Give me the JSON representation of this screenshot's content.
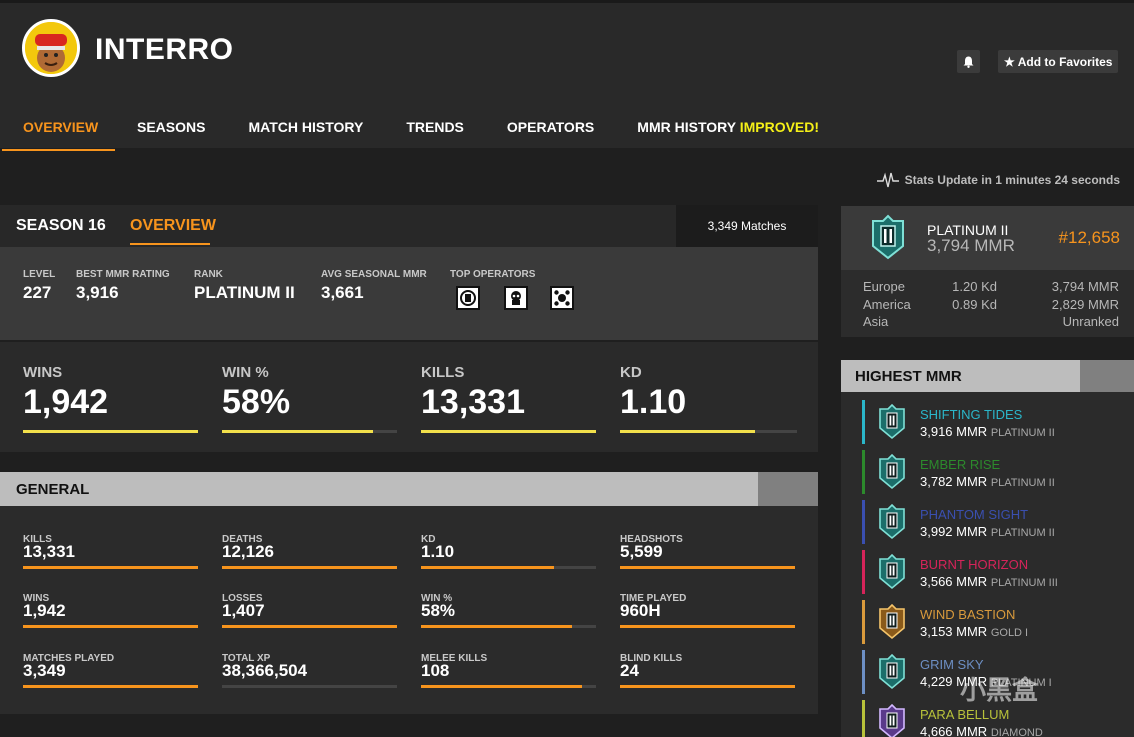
{
  "player": {
    "name": "INTERRO"
  },
  "header": {
    "favorites_label": "Add to Favorites"
  },
  "tabs": [
    {
      "label": "OVERVIEW"
    },
    {
      "label": "SEASONS"
    },
    {
      "label": "MATCH HISTORY"
    },
    {
      "label": "TRENDS"
    },
    {
      "label": "OPERATORS"
    },
    {
      "label": "MMR HISTORY",
      "badge": "IMPROVED!"
    }
  ],
  "stats_update": "Stats Update in 1 minutes 24 seconds",
  "season": {
    "label": "SEASON 16",
    "tab": "OVERVIEW",
    "matches": "3,349 Matches",
    "info": [
      {
        "label": "LEVEL",
        "value": "227"
      },
      {
        "label": "BEST MMR RATING",
        "value": "3,916"
      },
      {
        "label": "RANK",
        "value": "PLATINUM II"
      },
      {
        "label": "AVG SEASONAL MMR",
        "value": "3,661"
      },
      {
        "label": "TOP OPERATORS",
        "value": ""
      }
    ],
    "top_operator_icons": [
      "operator-1-icon",
      "operator-2-icon",
      "operator-3-icon"
    ]
  },
  "big_stats": [
    {
      "label": "WINS",
      "value": "1,942",
      "fill": 1.0
    },
    {
      "label": "WIN %",
      "value": "58%",
      "fill": 0.86
    },
    {
      "label": "KILLS",
      "value": "13,331",
      "fill": 1.0
    },
    {
      "label": "KD",
      "value": "1.10",
      "fill": 0.76
    }
  ],
  "general": {
    "title": "GENERAL",
    "stats": [
      {
        "label": "KILLS",
        "value": "13,331",
        "fill": 1.0
      },
      {
        "label": "DEATHS",
        "value": "12,126",
        "fill": 1.0
      },
      {
        "label": "KD",
        "value": "1.10",
        "fill": 0.76
      },
      {
        "label": "HEADSHOTS",
        "value": "5,599",
        "fill": 1.0
      },
      {
        "label": "WINS",
        "value": "1,942",
        "fill": 1.0
      },
      {
        "label": "LOSSES",
        "value": "1,407",
        "fill": 1.0
      },
      {
        "label": "WIN %",
        "value": "58%",
        "fill": 0.86
      },
      {
        "label": "TIME PLAYED",
        "value": "960H",
        "fill": 1.0
      },
      {
        "label": "MATCHES PLAYED",
        "value": "3,349",
        "fill": 1.0
      },
      {
        "label": "TOTAL XP",
        "value": "38,366,504",
        "fill": 0.0
      },
      {
        "label": "MELEE KILLS",
        "value": "108",
        "fill": 0.92
      },
      {
        "label": "BLIND KILLS",
        "value": "24",
        "fill": 1.0
      }
    ]
  },
  "rank_card": {
    "rank": "PLATINUM II",
    "mmr": "3,794 MMR",
    "position": "#12,658",
    "regions": [
      {
        "name": "Europe",
        "kd": "1.20 Kd",
        "mmr": "3,794 MMR"
      },
      {
        "name": "America",
        "kd": "0.89 Kd",
        "mmr": "2,829 MMR"
      },
      {
        "name": "Asia",
        "kd": "",
        "mmr": "Unranked"
      }
    ]
  },
  "highest_mmr": {
    "title": "HIGHEST MMR",
    "seasons": [
      {
        "name": "SHIFTING TIDES",
        "mmr": "3,916 MMR",
        "rank": "PLATINUM II",
        "color": "#2bb6c9"
      },
      {
        "name": "EMBER RISE",
        "mmr": "3,782 MMR",
        "rank": "PLATINUM II",
        "color": "#2c8a2c"
      },
      {
        "name": "PHANTOM SIGHT",
        "mmr": "3,992 MMR",
        "rank": "PLATINUM II",
        "color": "#3a4fb0"
      },
      {
        "name": "BURNT HORIZON",
        "mmr": "3,566 MMR",
        "rank": "PLATINUM III",
        "color": "#d6245a"
      },
      {
        "name": "WIND BASTION",
        "mmr": "3,153 MMR",
        "rank": "GOLD I",
        "color": "#d99a3c"
      },
      {
        "name": "GRIM SKY",
        "mmr": "4,229 MMR",
        "rank": "PLATINUM I",
        "color": "#6d8fc4"
      },
      {
        "name": "PARA BELLUM",
        "mmr": "4,666 MMR",
        "rank": "DIAMOND",
        "color": "#b8c23a"
      }
    ]
  },
  "watermark": "小黑盒",
  "colors": {
    "accent": "#f7941d",
    "bar_yellow": "#f2e04b",
    "improved": "#f5f018"
  }
}
